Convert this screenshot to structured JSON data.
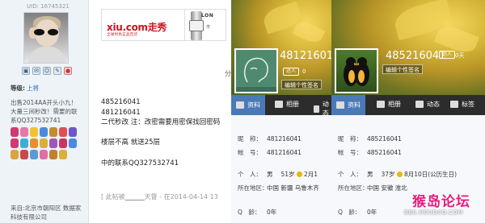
{
  "sidebar": {
    "uid_top": "UID: 16745321",
    "icons": [
      "profile-icon",
      "message-icon",
      "friend-icon",
      "mail-icon",
      "qq-icon"
    ],
    "level_label": "等级:",
    "level_value": "上将",
    "intro": "出售2014AA开头小九！大量三间秒改！需要的联系QQ327532741",
    "location": "来自:北京市朝阳区 数据家科技有限公司",
    "medal_colors": [
      "#d03a70",
      "#e27aa8",
      "#f2c12e",
      "#4a8be0",
      "#c58b2e",
      "#e05050",
      "#6c57c8",
      "#d03a70",
      "#3ab0d8",
      "#e88f2a",
      "#d8b13a",
      "#9b59b6",
      "#cc3366",
      "#4a8be0",
      "#d9a441",
      "#c94a4a",
      "#5b9bd5",
      "#e06fa5",
      "#c08030",
      "#d8b13a"
    ]
  },
  "post": {
    "ad_logo": "xiu.com走秀",
    "ad_tagline": "全球时尚正品百货",
    "ad2_brand": "LON",
    "ad2_sub": "市",
    "ad_note": "分",
    "lines": [
      "485216041",
      "481216041",
      "二代秒改  注：改密需要用密保找回密码",
      "",
      "楼层不高 就送25层",
      "",
      "中的联系QQ327532741"
    ],
    "signature_prefix": "[ 此帖被",
    "signature_user": "______",
    "signature_suffix": "天督 - 在2014-04-14 13"
  },
  "panel1": {
    "qq": "48121601",
    "badge": "达人",
    "badge_level": "0",
    "edit_sign": "编辑个性签名",
    "tabs": [
      {
        "label": "资料",
        "active": true
      },
      {
        "label": "相册",
        "active": false
      },
      {
        "label": "动态",
        "active": false
      }
    ],
    "rows": {
      "nickname_key": "昵　称：",
      "nickname_val": "481216041",
      "account_key": "帐　号：",
      "account_val": "481216041",
      "personal_key": "个　人：",
      "gender": "男",
      "age": "51岁",
      "birthday": "2月1",
      "location_key": "所在地区：",
      "location_val": "中国 新疆 乌鲁木齐",
      "qage_key": "Q　龄：",
      "qage_val": "0年"
    }
  },
  "panel2": {
    "qq": "485216041",
    "badge": "达人",
    "badge_level": "0天",
    "edit_sign": "编辑个性签名",
    "tabs": [
      {
        "label": "资料",
        "active": true
      },
      {
        "label": "相册",
        "active": false
      },
      {
        "label": "动态",
        "active": false
      },
      {
        "label": "标签",
        "active": false
      }
    ],
    "rows": {
      "nickname_key": "昵　称：",
      "nickname_val": "485216041",
      "account_key": "帐　号：",
      "account_val": "485216041",
      "personal_key": "个　人：",
      "gender": "男",
      "age": "37岁",
      "birthday": "8月10日(公历生日)",
      "location_key": "所在地区：",
      "location_val": "中国 安徽 淮北",
      "qage_key": "Q　龄：",
      "qage_val": "0年"
    }
  },
  "watermark": {
    "text": "猴岛论坛",
    "url": "BBS.HOUDAO.COM"
  }
}
